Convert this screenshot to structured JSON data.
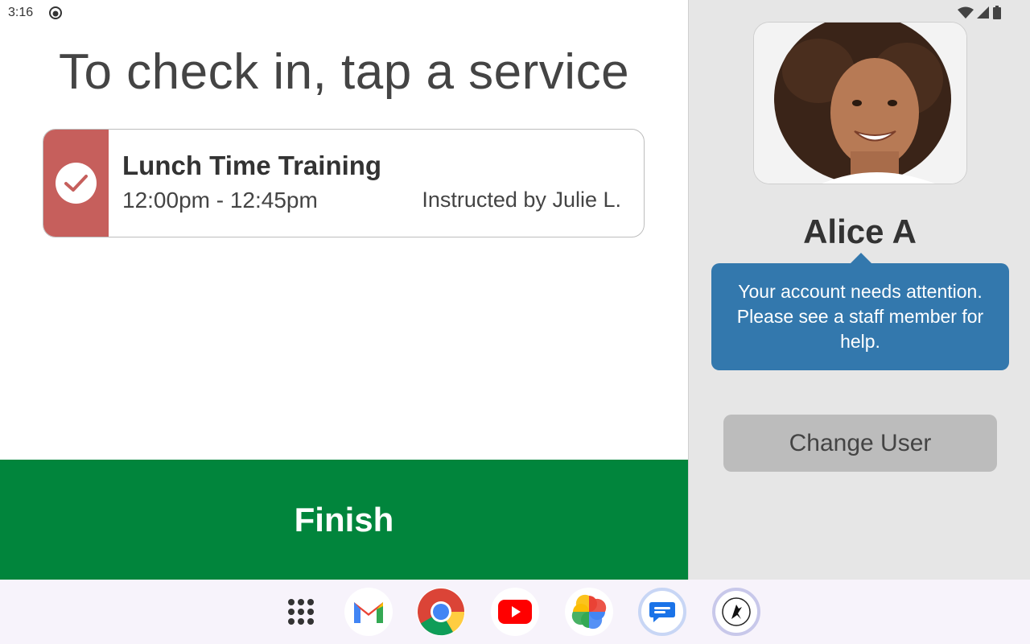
{
  "status_bar": {
    "time": "3:16"
  },
  "main": {
    "title": "To check in, tap a service",
    "service": {
      "name": "Lunch Time Training",
      "time": "12:00pm - 12:45pm",
      "instructor": "Instructed by Julie L.",
      "checked": true,
      "strip_color": "#c65f5c"
    },
    "finish_label": "Finish",
    "finish_color": "#01853c"
  },
  "user_panel": {
    "name": "Alice A",
    "message": "Your account needs attention. Please see a staff member for help.",
    "message_color": "#3378ad",
    "change_user_label": "Change User"
  },
  "taskbar": {
    "apps": [
      "app-drawer-icon",
      "gmail-icon",
      "chrome-icon",
      "youtube-icon",
      "photos-icon",
      "messages-icon",
      "checkin-app-icon"
    ]
  }
}
